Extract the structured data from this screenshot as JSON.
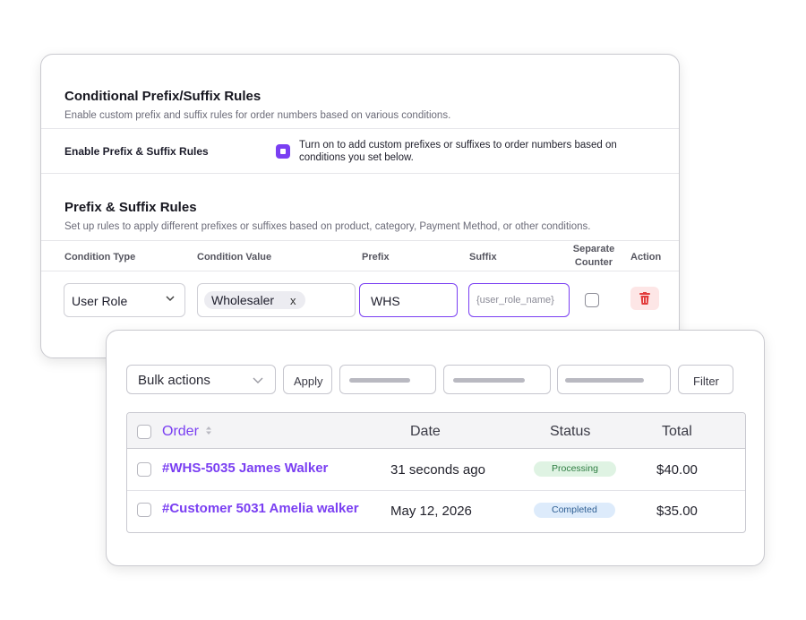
{
  "conditional_rules": {
    "title": "Conditional Prefix/Suffix Rules",
    "description": "Enable custom prefix and suffix rules for order numbers based on various conditions.",
    "enable_label": "Enable Prefix & Suffix Rules",
    "enable_text": "Turn on to add custom prefixes or suffixes to order numbers based on conditions you set below.",
    "enable_checked": true
  },
  "prefix_suffix_rules": {
    "title": "Prefix & Suffix Rules",
    "description": "Set up rules to apply different prefixes or suffixes based on product, category, Payment Method, or other conditions.",
    "columns": {
      "condition_type": "Condition Type",
      "condition_value": "Condition Value",
      "prefix": "Prefix",
      "suffix": "Suffix",
      "separate_counter_1": "Separate",
      "separate_counter_2": "Counter",
      "action": "Action"
    },
    "row": {
      "condition_type": "User Role",
      "condition_value_chip": "Wholesaler",
      "chip_remove": "x",
      "prefix": "WHS",
      "suffix_placeholder": "{user_role_name}",
      "separate_counter": false
    }
  },
  "orders": {
    "bulk_actions": "Bulk actions",
    "apply_label": "Apply",
    "filter_label": "Filter",
    "headers": {
      "order": "Order",
      "date": "Date",
      "status": "Status",
      "total": "Total"
    },
    "rows": [
      {
        "order": "#WHS-5035 James Walker",
        "date": "31 seconds ago",
        "status": "Processing",
        "total": "$40.00"
      },
      {
        "order": "#Customer 5031 Amelia walker",
        "date": "May 12, 2026",
        "status": "Completed",
        "total": "$35.00"
      }
    ]
  },
  "colors": {
    "accent": "#7a3ff2",
    "processing_bg": "#dff3e3",
    "completed_bg": "#ddebfb",
    "delete": "#e23b3b"
  },
  "icons": [
    "chevron-down-icon",
    "trash-icon",
    "sort-icon"
  ]
}
